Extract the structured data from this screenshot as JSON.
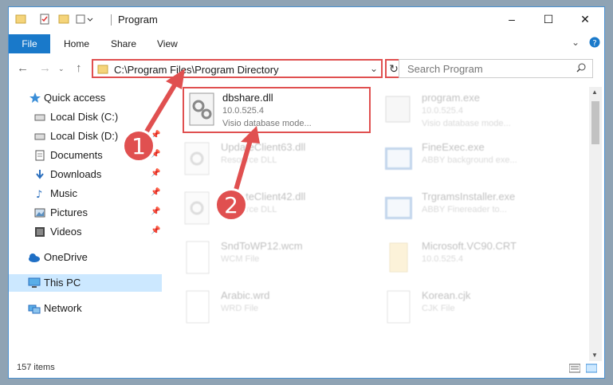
{
  "window": {
    "title": "Program"
  },
  "ribbon": {
    "file": "File",
    "tabs": [
      "Home",
      "Share",
      "View"
    ]
  },
  "address": {
    "path": "C:\\Program Files\\Program Directory",
    "search_placeholder": "Search Program"
  },
  "sidebar": {
    "quick_access": "Quick access",
    "items": [
      {
        "label": "Local Disk (C:)",
        "icon": "drive-icon"
      },
      {
        "label": "Local Disk (D:)",
        "icon": "drive-icon"
      },
      {
        "label": "Documents",
        "icon": "documents-icon"
      },
      {
        "label": "Downloads",
        "icon": "downloads-icon"
      },
      {
        "label": "Music",
        "icon": "music-icon"
      },
      {
        "label": "Pictures",
        "icon": "pictures-icon"
      },
      {
        "label": "Videos",
        "icon": "videos-icon"
      }
    ],
    "onedrive": "OneDrive",
    "this_pc": "This PC",
    "network": "Network"
  },
  "files": [
    {
      "name": "dbshare.dll",
      "line1": "10.0.525.4",
      "line2": "Visio database mode..."
    },
    {
      "name": "program.exe",
      "line1": "10.0.525.4",
      "line2": "Visio database mode..."
    },
    {
      "name": "UpdateClient63.dll",
      "line1": "Resource DLL",
      "line2": ""
    },
    {
      "name": "FineExec.exe",
      "line1": "ABBY background exe...",
      "line2": ""
    },
    {
      "name": "UpdateClient42.dll",
      "line1": "Resource DLL",
      "line2": ""
    },
    {
      "name": "TrgramsInstaller.exe",
      "line1": "ABBY Finereader to...",
      "line2": ""
    },
    {
      "name": "SndToWP12.wcm",
      "line1": "WCM File",
      "line2": ""
    },
    {
      "name": "Microsoft.VC90.CRT",
      "line1": "10.0.525.4",
      "line2": ""
    },
    {
      "name": "Arabic.wrd",
      "line1": "WRD File",
      "line2": ""
    },
    {
      "name": "Korean.cjk",
      "line1": "CJK File",
      "line2": ""
    }
  ],
  "status": {
    "count": "157 items"
  },
  "callouts": {
    "one": "1",
    "two": "2"
  },
  "colors": {
    "accent": "#1979ca",
    "highlight": "#e05050",
    "selected": "#cce8ff"
  }
}
